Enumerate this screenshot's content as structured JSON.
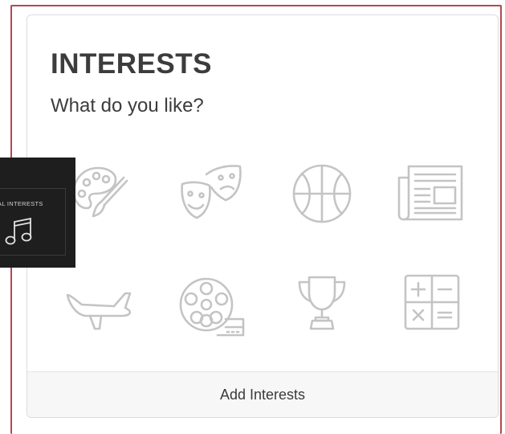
{
  "card": {
    "title": "INTERESTS",
    "subtitle": "What do you like?",
    "footer_button": "Add Interests"
  },
  "icons": [
    {
      "name": "art-palette-icon"
    },
    {
      "name": "theater-masks-icon"
    },
    {
      "name": "basketball-icon"
    },
    {
      "name": "newspaper-icon"
    },
    {
      "name": "airplane-icon"
    },
    {
      "name": "film-reel-icon"
    },
    {
      "name": "trophy-icon"
    },
    {
      "name": "calculator-icon"
    }
  ],
  "overlay": {
    "label": "ERAL INTERESTS",
    "icon": "music-note-icon"
  },
  "colors": {
    "frame": "#b2484f",
    "icon": "#c4c4c4",
    "title": "#3c3c3c",
    "footer_bg": "#f7f7f7",
    "overlay_bg": "#1e1e1e"
  }
}
